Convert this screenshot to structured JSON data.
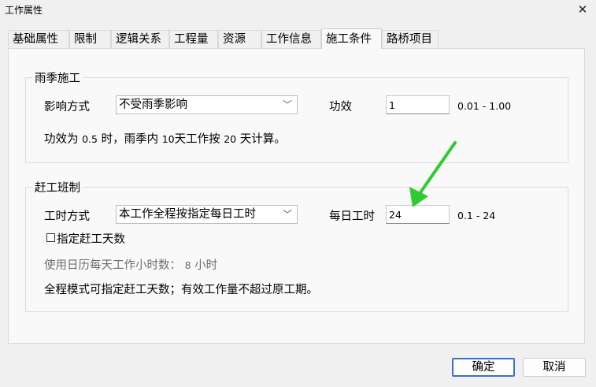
{
  "window": {
    "title": "工作属性",
    "close_glyph": "✕"
  },
  "tabs": [
    {
      "label": "基础属性"
    },
    {
      "label": "限制"
    },
    {
      "label": "逻辑关系"
    },
    {
      "label": "工程量"
    },
    {
      "label": "资源"
    },
    {
      "label": "工作信息"
    },
    {
      "label": "施工条件",
      "active": true
    },
    {
      "label": "路桥项目"
    }
  ],
  "rainy": {
    "group_title": "雨季施工",
    "mode_label": "影响方式",
    "mode_value": "不受雨季影响",
    "eff_label": "功效",
    "eff_value": "1",
    "eff_range": "0.01 - 1.00",
    "note": {
      "p1": "功效为",
      "v1": "0.5",
      "p2": "时，雨季内",
      "v2": "10",
      "p3": "天工作按",
      "v3": "20",
      "p4": "天计算。"
    }
  },
  "rush": {
    "group_title": "赶工班制",
    "hour_mode_label": "工时方式",
    "hour_mode_value": "本工作全程按指定每日工时",
    "daily_label": "每日工时",
    "daily_value": "24",
    "daily_range": "0.1 - 24",
    "checkbox_label": "指定赶工天数",
    "calendar_note": {
      "p1": "使用日历每天工作小时数：",
      "v1": "8",
      "p2": "小时"
    },
    "footer_note": "全程模式可指定赶工天数；有效工作量不超过原工期。"
  },
  "buttons": {
    "ok": "确定",
    "cancel": "取消"
  },
  "annotation": {
    "arrow_color": "#2ecc2e"
  }
}
